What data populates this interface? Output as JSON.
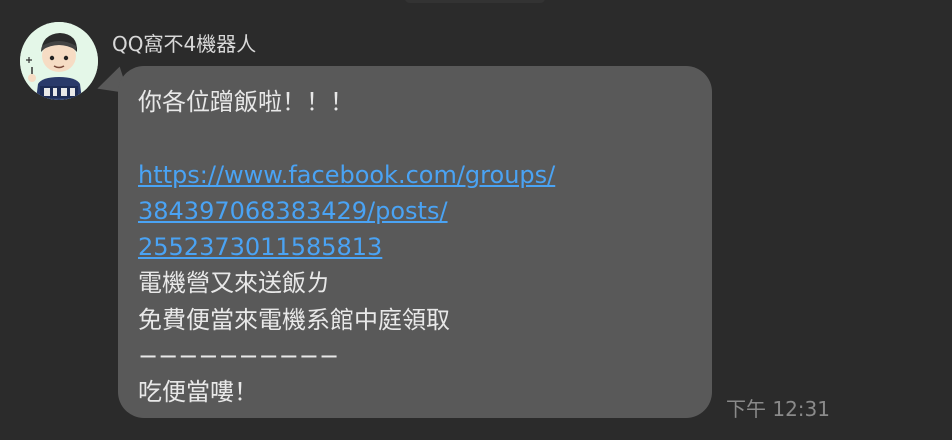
{
  "chat": {
    "sender_name": "QQ窩不4機器人",
    "avatar": {
      "icon": "cartoon-boy-avatar-icon",
      "bg_color": "#e4f7e8"
    },
    "message": {
      "line1": "你各位蹭飯啦！！！",
      "link_line1": "https://www.facebook.com/groups/",
      "link_line2": "384397068383429/posts/",
      "link_line3": "2552373011585813",
      "line5": "電機營又來送飯ㄌ",
      "line6": "免費便當來電機系館中庭領取",
      "line7": "−−−−−−−−−−",
      "line8": "吃便當嘍！"
    },
    "timestamp": "下午 12:31",
    "colors": {
      "background": "#2b2b2b",
      "bubble": "#595959",
      "text": "#e8e8e8",
      "link": "#4aa3f4",
      "timestamp": "#8a8a8a"
    }
  }
}
